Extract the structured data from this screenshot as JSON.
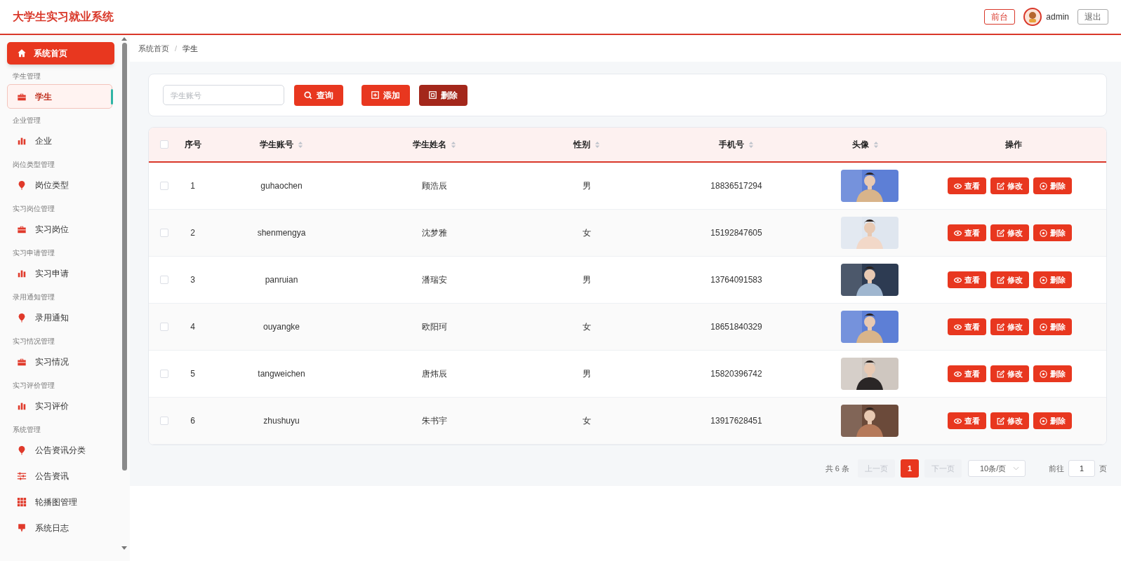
{
  "header": {
    "title": "大学生实习就业系统",
    "front_button": "前台",
    "user": "admin",
    "logout_button": "退出"
  },
  "sidebar": {
    "home": "系统首页",
    "groups": [
      {
        "title": "学生管理",
        "items": [
          {
            "label": "学生",
            "selected": true
          }
        ]
      },
      {
        "title": "企业管理",
        "items": [
          {
            "label": "企业",
            "selected": false
          }
        ]
      },
      {
        "title": "岗位类型管理",
        "items": [
          {
            "label": "岗位类型",
            "selected": false
          }
        ]
      },
      {
        "title": "实习岗位管理",
        "items": [
          {
            "label": "实习岗位",
            "selected": false
          }
        ]
      },
      {
        "title": "实习申请管理",
        "items": [
          {
            "label": "实习申请",
            "selected": false
          }
        ]
      },
      {
        "title": "录用通知管理",
        "items": [
          {
            "label": "录用通知",
            "selected": false
          }
        ]
      },
      {
        "title": "实习情况管理",
        "items": [
          {
            "label": "实习情况",
            "selected": false
          }
        ]
      },
      {
        "title": "实习评价管理",
        "items": [
          {
            "label": "实习评价",
            "selected": false
          }
        ]
      },
      {
        "title": "系统管理",
        "items": [
          {
            "label": "公告资讯分类",
            "selected": false
          },
          {
            "label": "公告资讯",
            "selected": false
          },
          {
            "label": "轮播图管理",
            "selected": false
          },
          {
            "label": "系统日志",
            "selected": false
          }
        ]
      }
    ]
  },
  "breadcrumb": [
    "系统首页",
    "学生"
  ],
  "breadcrumb_separator": "/",
  "toolbar": {
    "search": {
      "placeholder": "学生账号"
    },
    "query_button": "查询",
    "add_button": "添加",
    "delete_button": "删除"
  },
  "table": {
    "select_all_checked": false,
    "columns": [
      {
        "label": "序号",
        "sortable": false
      },
      {
        "label": "学生账号",
        "sortable": true
      },
      {
        "label": "学生姓名",
        "sortable": true
      },
      {
        "label": "性别",
        "sortable": true
      },
      {
        "label": "手机号",
        "sortable": true
      },
      {
        "label": "头像",
        "sortable": true
      },
      {
        "label": "操作",
        "sortable": false
      }
    ],
    "rows": [
      {
        "checked": false,
        "index": "1",
        "account": "guhaochen",
        "name": "顾浩辰",
        "gender": "男",
        "phone": "18836517294",
        "avatar": {
          "kind": "picture"
        },
        "actions": [
          "查看",
          "修改",
          "删除"
        ]
      },
      {
        "checked": false,
        "index": "2",
        "account": "shenmengya",
        "name": "沈梦雅",
        "gender": "女",
        "phone": "15192847605",
        "avatar": {
          "kind": "picture"
        },
        "actions": [
          "查看",
          "修改",
          "删除"
        ]
      },
      {
        "checked": false,
        "index": "3",
        "account": "panruian",
        "name": "潘瑞安",
        "gender": "男",
        "phone": "13764091583",
        "avatar": {
          "kind": "picture"
        },
        "actions": [
          "查看",
          "修改",
          "删除"
        ]
      },
      {
        "checked": false,
        "index": "4",
        "account": "ouyangke",
        "name": "欧阳珂",
        "gender": "女",
        "phone": "18651840329",
        "avatar": {
          "kind": "picture"
        },
        "actions": [
          "查看",
          "修改",
          "删除"
        ]
      },
      {
        "checked": false,
        "index": "5",
        "account": "tangweichen",
        "name": "唐炜辰",
        "gender": "男",
        "phone": "15820396742",
        "avatar": {
          "kind": "picture"
        },
        "actions": [
          "查看",
          "修改",
          "删除"
        ]
      },
      {
        "checked": false,
        "index": "6",
        "account": "zhushuyu",
        "name": "朱书宇",
        "gender": "女",
        "phone": "13917628451",
        "avatar": {
          "kind": "picture"
        },
        "actions": [
          "查看",
          "修改",
          "删除"
        ]
      }
    ]
  },
  "pagination": {
    "total": "共 6 条",
    "prev": "上一页",
    "pages": [
      {
        "label": "1",
        "selected": true
      }
    ],
    "next": "下一页",
    "page_size": "10条/页",
    "goto_label": "前往",
    "goto_value": "1",
    "goto_suffix": "页"
  }
}
